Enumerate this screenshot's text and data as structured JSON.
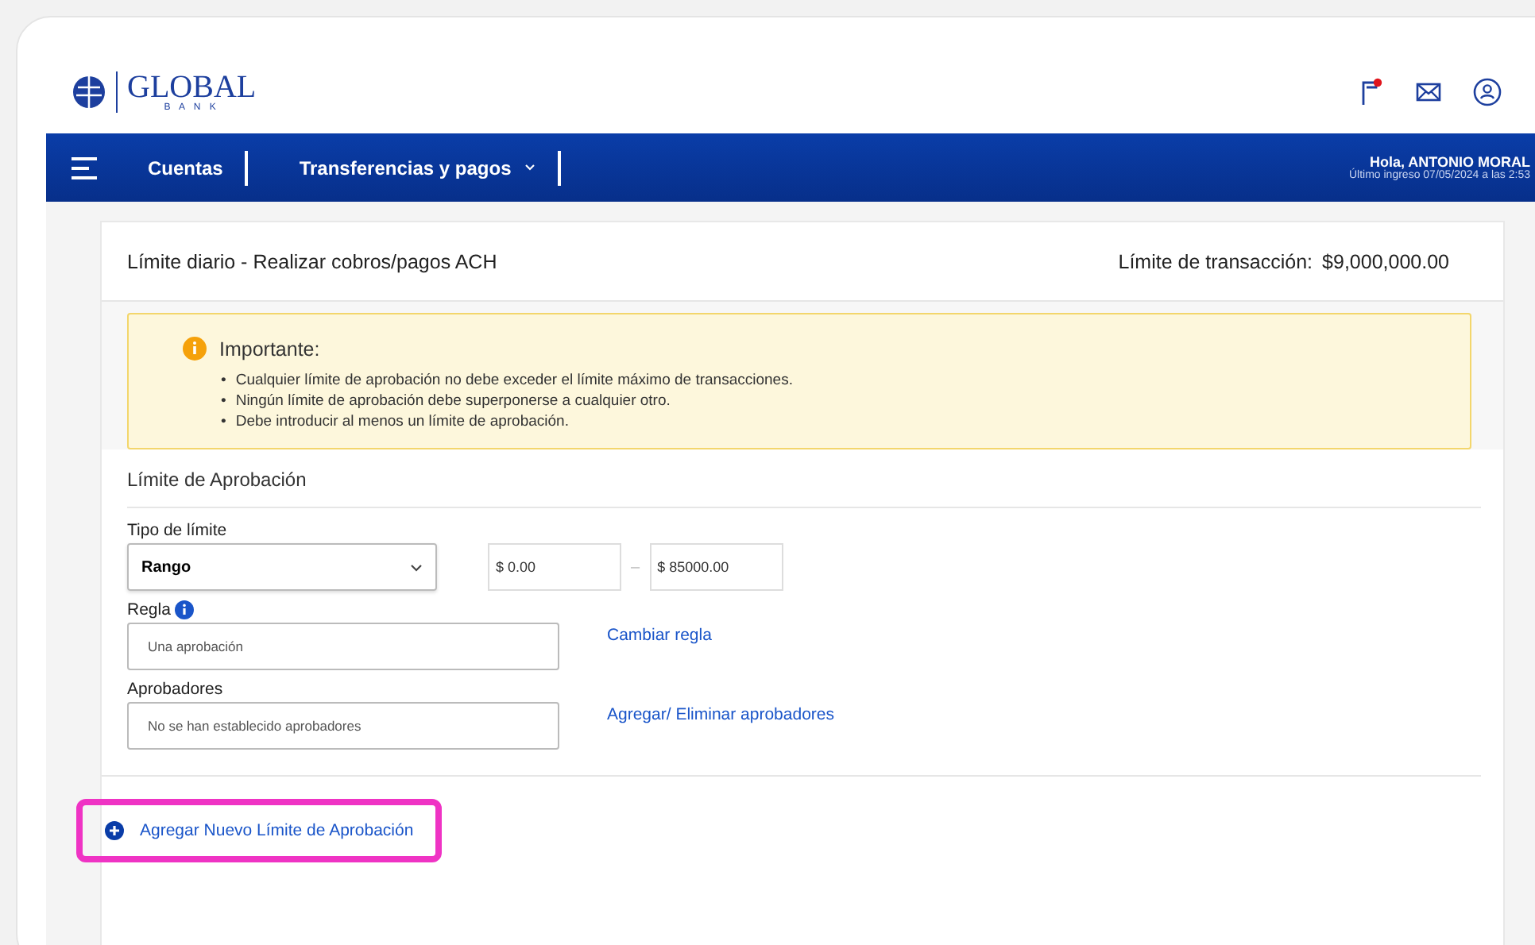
{
  "header": {
    "logo_word": "GLOBAL",
    "logo_sub": "B A N K",
    "notification_dot": true
  },
  "nav": {
    "items": [
      {
        "label": "Cuentas",
        "dropdown": false
      },
      {
        "label": "Transferencias y pagos",
        "dropdown": true
      }
    ],
    "greeting": "Hola, ANTONIO MORAL",
    "last_login": "Último ingreso 07/05/2024 a las 2:53"
  },
  "card": {
    "title": "Límite diario - Realizar cobros/pagos ACH",
    "limit_label": "Límite de transacción:",
    "limit_value": "$9,000,000.00",
    "notice": {
      "title": "Importante:",
      "bullet": "•",
      "items": [
        "Cualquier límite de aprobación no debe exceder el límite máximo de transacciones.",
        "Ningún límite de aprobación debe superponerse a cualquier otro.",
        "Debe introducir al menos un límite de aprobación."
      ]
    },
    "section_title": "Límite de Aprobación",
    "limit_type": {
      "label": "Tipo de límite",
      "value": "Rango",
      "min": "$ 0.00",
      "separator": "–",
      "max": "$ 85000.00"
    },
    "rule": {
      "label": "Regla",
      "value": "Una aprobación",
      "link": "Cambiar regla"
    },
    "approvers": {
      "label": "Aprobadores",
      "value": "No se han establecido aprobadores",
      "link": "Agregar/ Eliminar aprobadores"
    },
    "add_link": {
      "label": "Agregar Nuevo Límite de Aprobación",
      "highlighted": true
    }
  }
}
